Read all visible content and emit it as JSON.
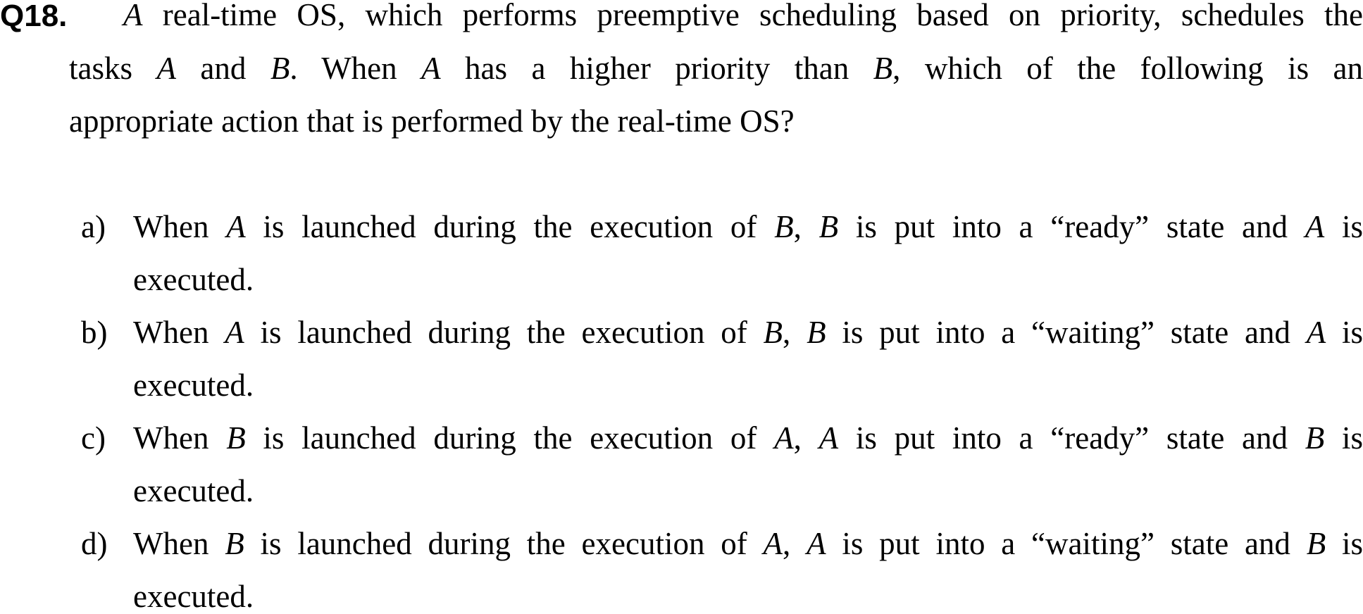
{
  "question": {
    "number": "Q18.",
    "lines": [
      "A real-time OS, which performs preemptive scheduling based on priority, schedules the",
      "tasks A and B.  When A has a higher priority than B, which of the following is an",
      "appropriate action that is performed by the real-time OS?"
    ]
  },
  "options": [
    {
      "letter": "a)",
      "line1": "When A is launched during the execution of B, B is put into a “ready” state and A is",
      "line2": "executed."
    },
    {
      "letter": "b)",
      "line1": "When A is launched during the execution of B, B is put into a “waiting” state and A is",
      "line2": "executed."
    },
    {
      "letter": "c)",
      "line1": "When B is launched during the execution of A, A is put into a “ready” state and B is",
      "line2": "executed."
    },
    {
      "letter": "d)",
      "line1": "When B is launched during the execution of A, A is put into a “waiting” state and B is",
      "line2": "executed."
    }
  ]
}
